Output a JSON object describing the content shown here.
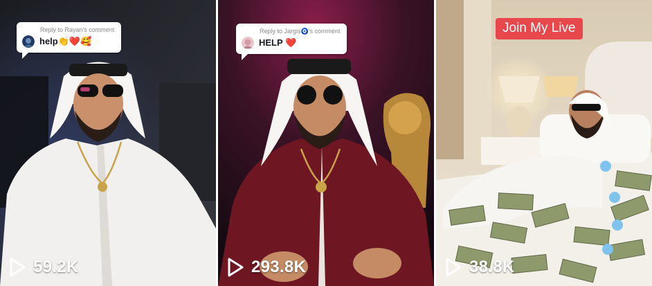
{
  "videos": [
    {
      "reply": {
        "caption": "Reply to Rayan's comment",
        "text": "help👏❤️🥰"
      },
      "views": "59.2K"
    },
    {
      "reply": {
        "caption": "Reply to Jargis🧿's comment",
        "text": "HELP ❤️"
      },
      "views": "293.8K"
    },
    {
      "badge": "Join My Live",
      "views": "38.8K"
    }
  ],
  "colors": {
    "badge_red": "#e8474c",
    "tile1_shirt": "#f2f0ee",
    "tile2_robe": "#6e1622",
    "tile3_bed": "#f3efe9"
  },
  "icons": [
    "play-icon",
    "commenter-avatar",
    "like-hand-icon"
  ]
}
